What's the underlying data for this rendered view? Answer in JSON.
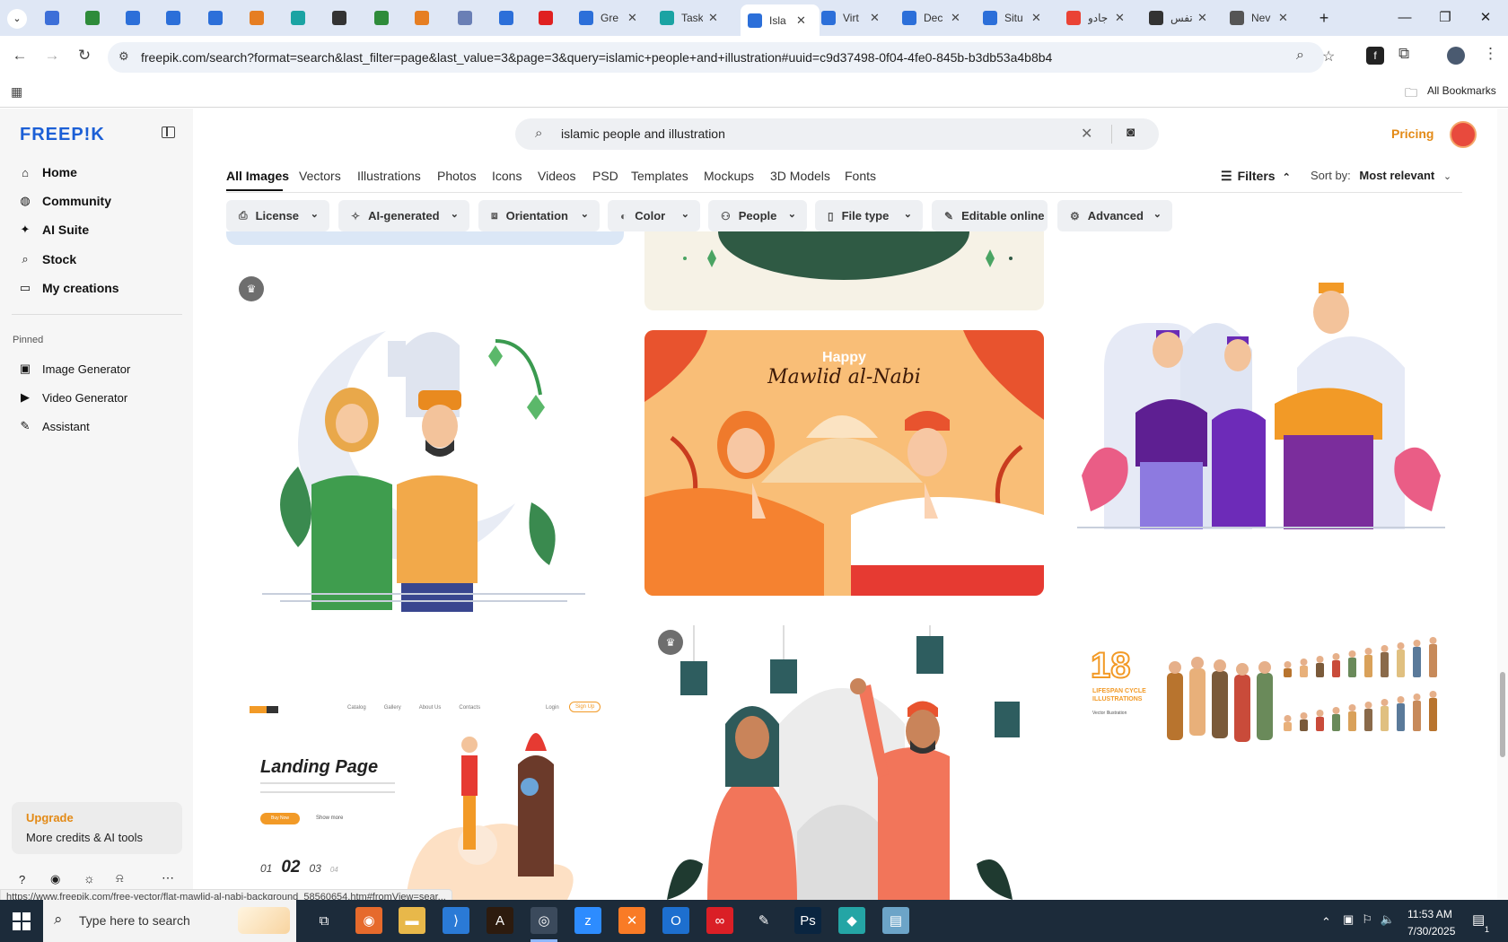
{
  "browser": {
    "tabs": [
      {
        "title": "",
        "color": "#3d6fd8"
      },
      {
        "title": "",
        "color": "#2e8b3a"
      },
      {
        "title": "",
        "color": "#2c6fd9"
      },
      {
        "title": "",
        "color": "#2c6fd9"
      },
      {
        "title": "",
        "color": "#2c6fd9"
      },
      {
        "title": "",
        "color": "#e67e22"
      },
      {
        "title": "",
        "color": "#1aa3a3"
      },
      {
        "title": "",
        "color": "#333333"
      },
      {
        "title": "",
        "color": "#2e8b3a"
      },
      {
        "title": "",
        "color": "#e67e22"
      },
      {
        "title": "",
        "color": "#6a7fb5"
      },
      {
        "title": "",
        "color": "#2c6fd9"
      },
      {
        "title": "",
        "color": "#e02020"
      },
      {
        "title": "Gre",
        "color": "#2c6fd9"
      },
      {
        "title": "Task",
        "color": "#1aa3a3"
      },
      {
        "title": "Isla",
        "color": "#2c6fd9"
      },
      {
        "title": "Virt",
        "color": "#2c6fd9"
      },
      {
        "title": "Dec",
        "color": "#2c6fd9"
      },
      {
        "title": "Situ",
        "color": "#2c6fd9"
      },
      {
        "title": "جادو",
        "color": "#ea4335"
      },
      {
        "title": "تفس",
        "color": "#333333"
      },
      {
        "title": "Nev",
        "color": "#555555"
      }
    ],
    "url": "freepik.com/search?format=search&last_filter=page&last_value=3&page=3&query=islamic+people+and+illustration#uuid=c9d37498-0f04-4fe0-845b-b3db53a4b8b4",
    "all_bookmarks": "All Bookmarks",
    "status_url": "https://www.freepik.com/free-vector/flat-mawlid-al-nabi-background_58560654.htm#fromView=sear..."
  },
  "site": {
    "logo": "FREEP!K",
    "accent": "#1c5fd6",
    "orange": "#e38a16",
    "nav": [
      "Home",
      "Community",
      "AI Suite",
      "Stock",
      "My creations"
    ],
    "pinned_label": "Pinned",
    "pinned": [
      "Image Generator",
      "Video Generator",
      "Assistant"
    ],
    "upgrade_title": "Upgrade",
    "upgrade_text": "More credits & AI tools",
    "search_value": "islamic people and illustration",
    "pricing": "Pricing",
    "categories": [
      "All Images",
      "Vectors",
      "Illustrations",
      "Photos",
      "Icons",
      "Videos",
      "PSD",
      "Templates",
      "Mockups",
      "3D Models",
      "Fonts"
    ],
    "filters_label": "Filters",
    "sort_label": "Sort by:",
    "sort_value": "Most relevant",
    "chips": [
      "License",
      "AI-generated",
      "Orientation",
      "Color",
      "People",
      "File type",
      "Editable online",
      "Advanced"
    ]
  },
  "cards": {
    "mawlid_happy": "Happy",
    "mawlid_title": "Mawlid al-Nabi",
    "landing_nav": [
      "Catalog",
      "Gallery",
      "About Us",
      "Contacts"
    ],
    "landing_login": "Login",
    "landing_signup": "Sign Up",
    "landing_title": "Landing Page",
    "landing_btn": "Buy Now",
    "landing_more": "Show more",
    "landing_pages": [
      "01",
      "02",
      "03",
      "04"
    ],
    "lifespan_number": "18",
    "lifespan_title": "LIFESPAN CYCLE ILLUSTRATIONS",
    "lifespan_sub": "Vector Illustration"
  },
  "taskbar": {
    "search_placeholder": "Type here to search",
    "time": "11:53 AM",
    "date": "7/30/2025",
    "notifications": "1"
  }
}
